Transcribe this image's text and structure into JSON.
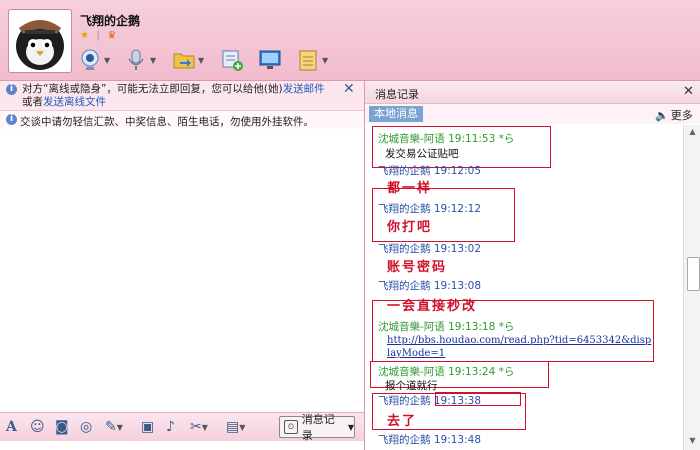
{
  "header": {
    "contact_name": "飞翔的企鹅",
    "status_sep": "|"
  },
  "left": {
    "notice_part1": "对方“离线或隐身”，可能无法立即回复，您可以给他(她)",
    "notice_link1": "发送邮件",
    "notice_part2": "或者",
    "notice_link2": "发送离线文件",
    "tip": "交谈中请勿轻信汇款、中奖信息、陌生电话，勿使用外挂软件。",
    "history_button": "消息记录"
  },
  "right": {
    "title": "消息记录",
    "tab_local": "本地消息",
    "more": "更多",
    "messages": [
      {
        "meta": "沈城音樂-阿语 19:11:53  *ら",
        "body": "发交易公证贴吧"
      },
      {
        "meta": "飞翔的企鹅 19:12:05"
      },
      {
        "meta": "飞翔的企鹅 19:12:12"
      },
      {
        "meta": "飞翔的企鹅 19:13:02"
      },
      {
        "meta": "飞翔的企鹅 19:13:08"
      },
      {
        "meta": "沈城音樂-阿语 19:13:18  *ら",
        "body": "http://bbs.houdao.com/read.php?tid=6453342&displayMode=1"
      },
      {
        "meta": "沈城音樂-阿语 19:13:24  *ら",
        "body": "报个道就行"
      },
      {
        "meta": "飞翔的企鹅 19:13:38"
      },
      {
        "meta": "飞翔的企鹅 19:13:48"
      }
    ],
    "annotations": [
      "都一样",
      "你打吧",
      "账号密码",
      "一会直接秒改",
      "去了"
    ]
  }
}
